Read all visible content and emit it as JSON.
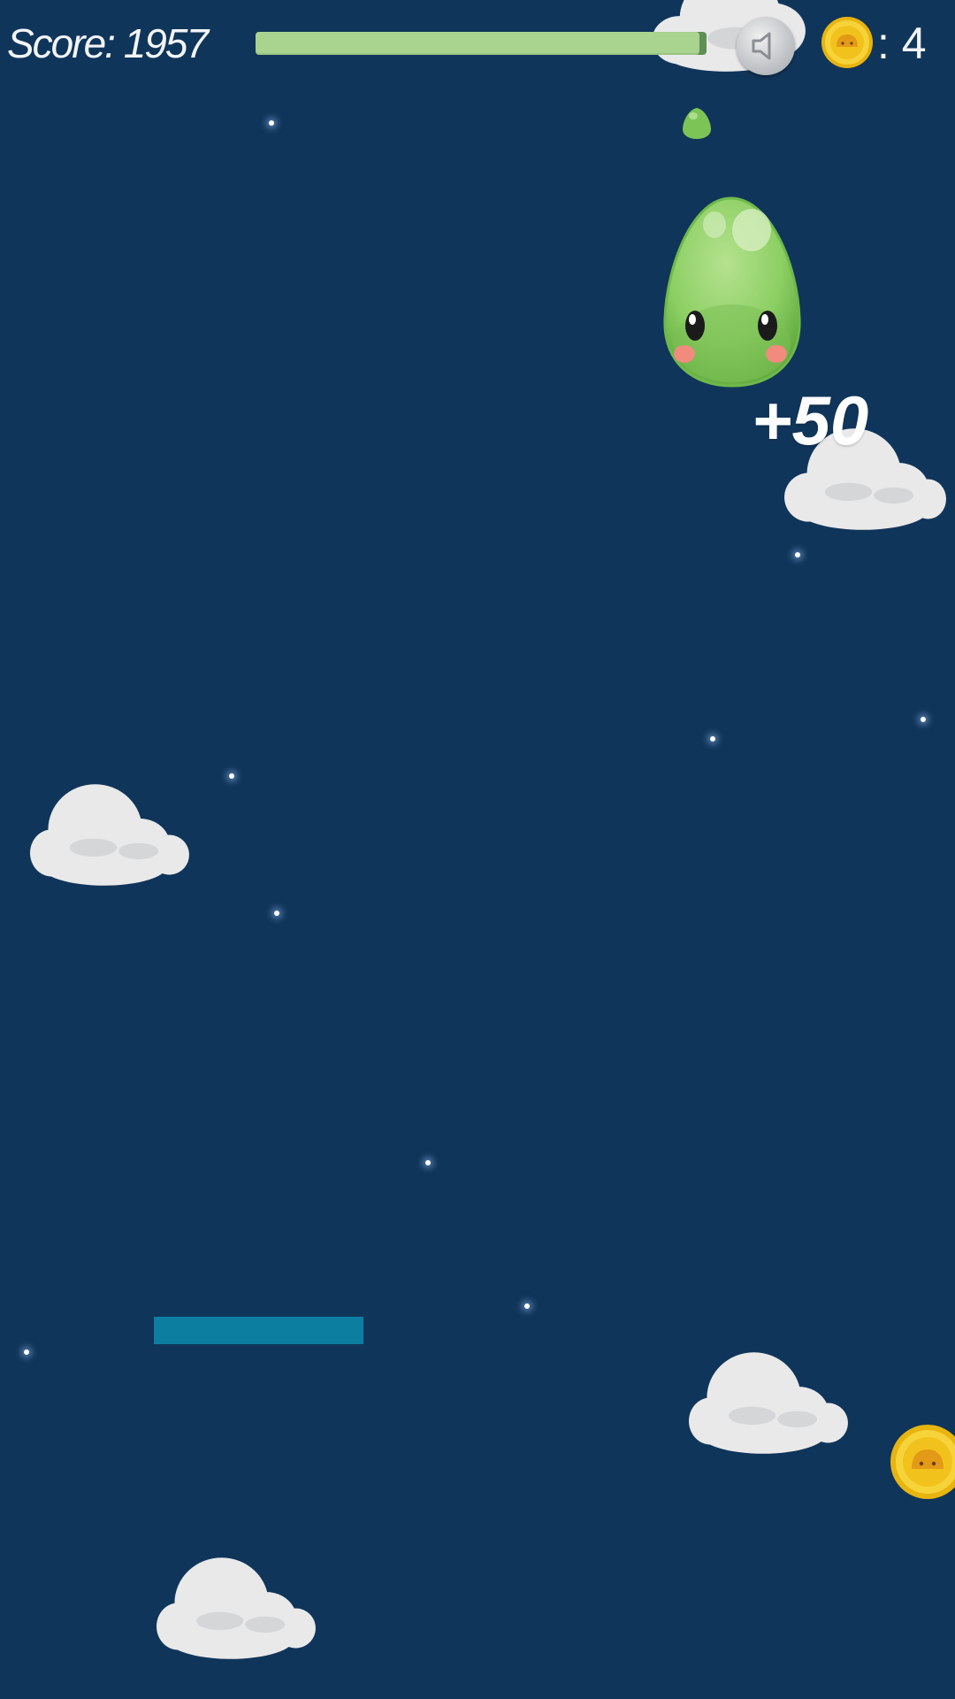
{
  "hud": {
    "score_text": "Score: 1957",
    "progress_fraction": 0.985,
    "coin_separator": ": ",
    "coin_count": "4",
    "sound_icon": "speaker-icon",
    "coin_icon": "coin-icon"
  },
  "world": {
    "bonus_text": "+50",
    "player": "green-slime",
    "pickup": "coin-icon"
  },
  "colors": {
    "background": "#10355a",
    "progress_fill": "#a8d48f",
    "progress_track": "#5f8f54",
    "platform": "#0c7ea0",
    "slime": "#8fd06a",
    "coin": "#f5c518"
  }
}
